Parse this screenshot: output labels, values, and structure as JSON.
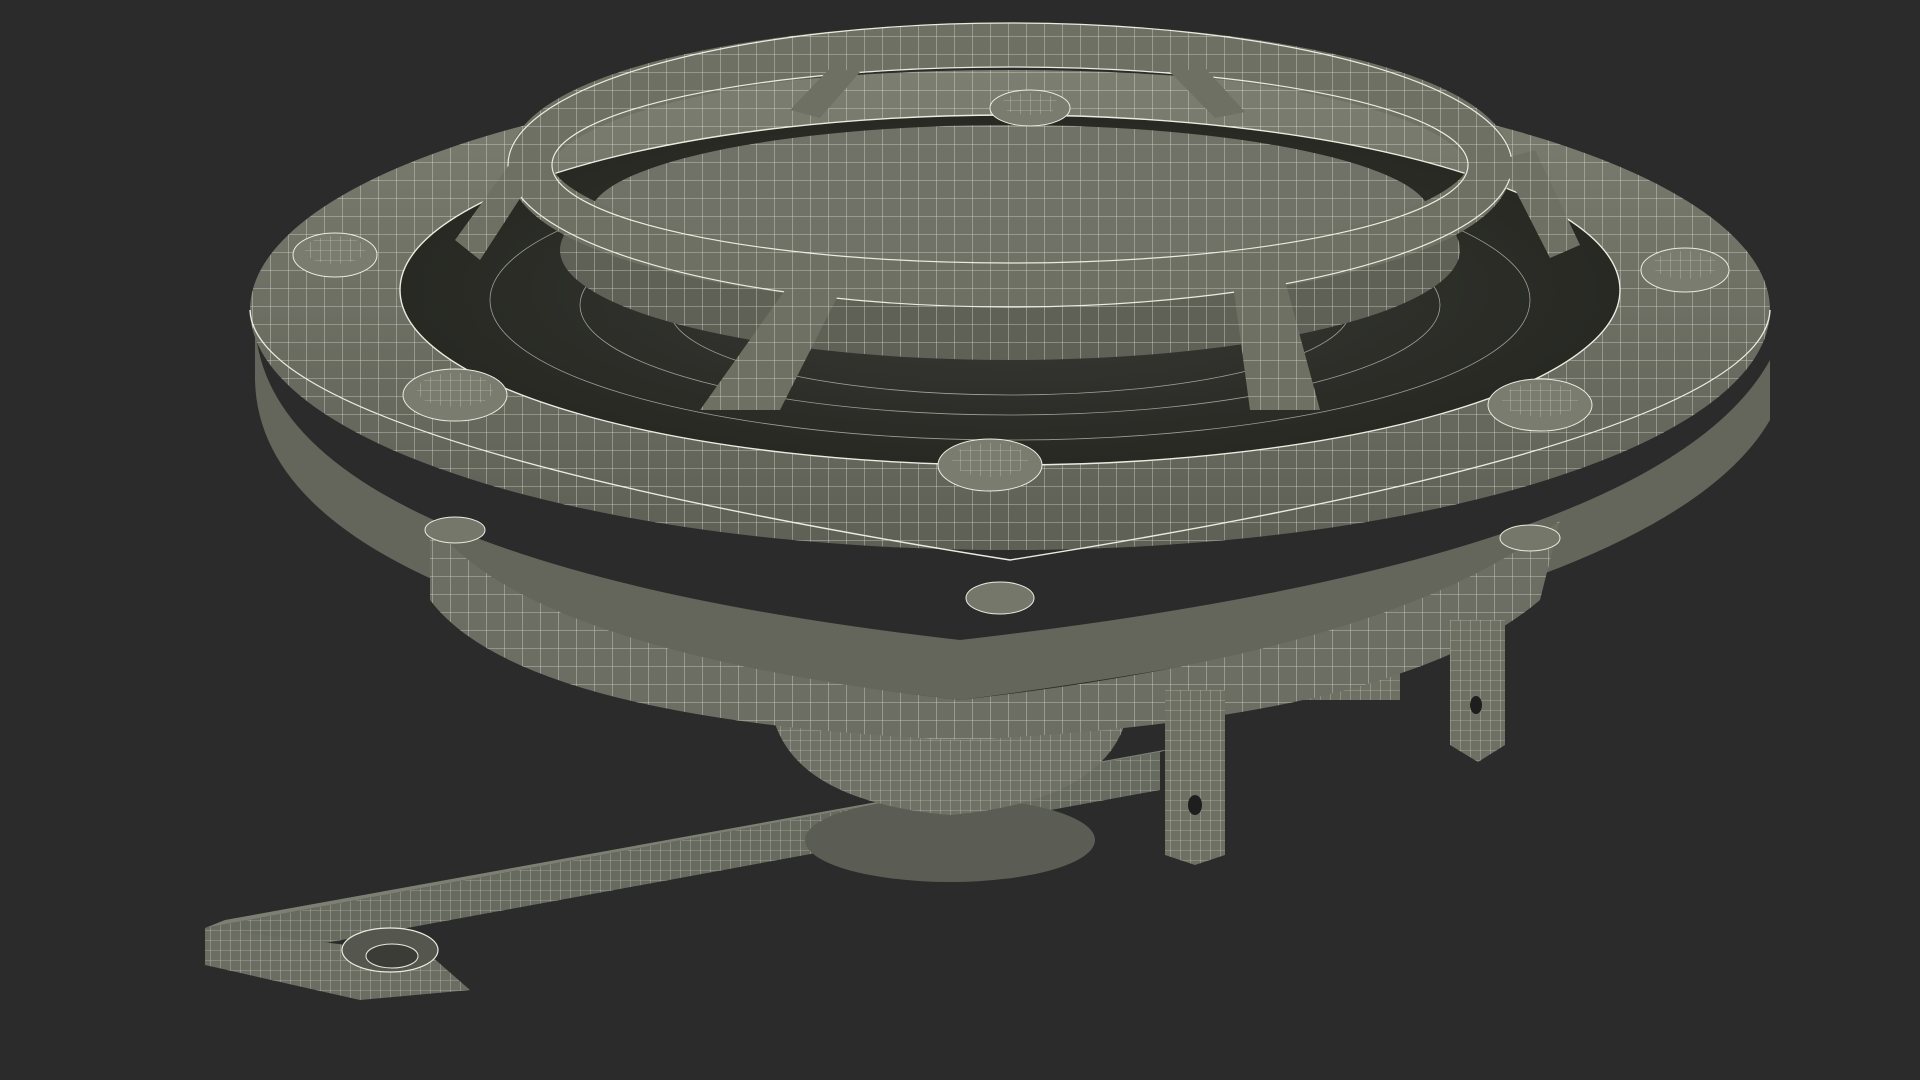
{
  "scene": {
    "subject": "wireframe-render-speaker-horn",
    "background_color": "#2b2b2b",
    "surface_color": "#6e7064",
    "surface_dark": "#4f5148",
    "surface_light": "#85877a",
    "wire_color": "#ecebe0",
    "shadow_color": "#1c1c1c",
    "bolt_count_visible": 6,
    "terminal_count": 2
  }
}
